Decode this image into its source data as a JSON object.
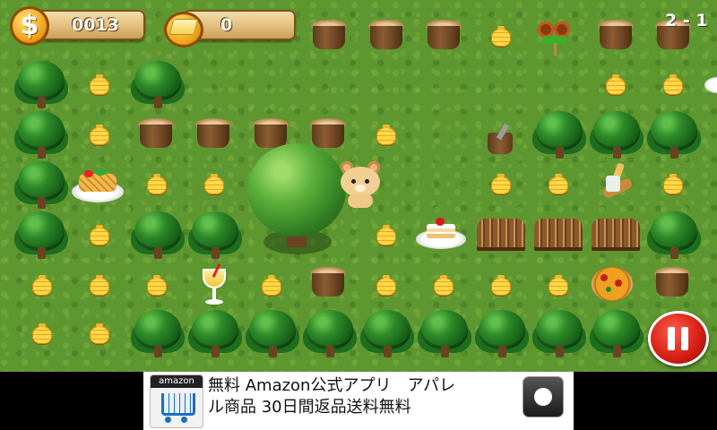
{
  "hud": {
    "coin_symbol": "$",
    "coin_count": "0013",
    "butter_count": "0",
    "level": "2 - 1"
  },
  "ad": {
    "app_icon_label": "amazon",
    "text_line1": "無料 Amazon公式アプリ　アパレ",
    "text_line2": "ル商品 30日間返品送料無料",
    "browser_icon": "globe-icon"
  },
  "colors": {
    "grass": "#5e9630",
    "hud_panel": "#e2bd7c",
    "pause_red": "#d41c12",
    "ad_background": "#ffffff"
  },
  "icons": [
    "coin-icon",
    "butter-icon",
    "pause-icon",
    "globe-icon",
    "honey-pot-icon",
    "tree-icon",
    "stump-icon",
    "bear-icon",
    "food-icon"
  ]
}
